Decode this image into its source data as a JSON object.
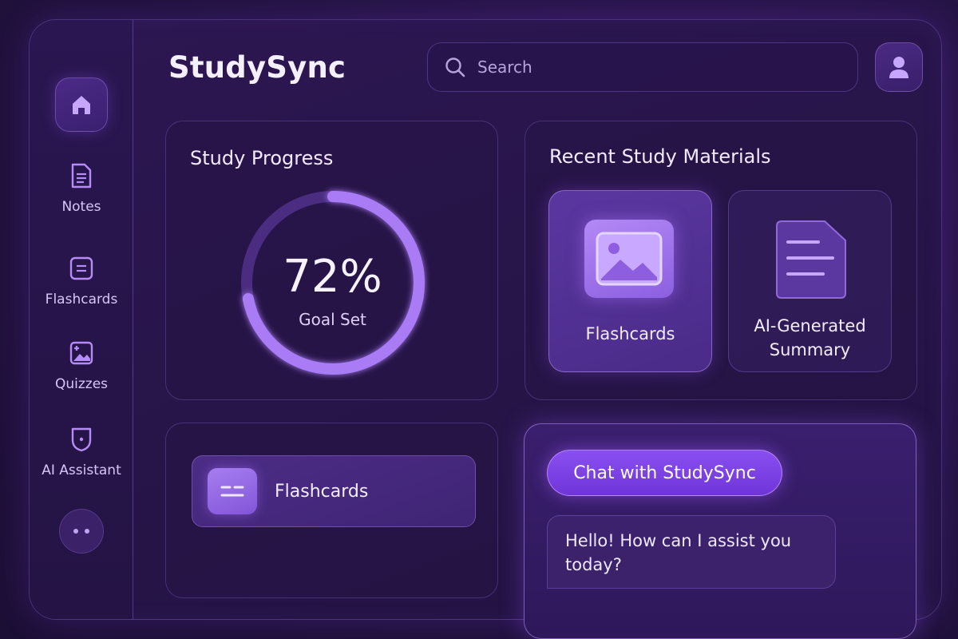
{
  "app": {
    "title": "StudySync"
  },
  "search": {
    "placeholder": "Search",
    "icon": "search-icon"
  },
  "header": {
    "avatar_icon": "user-icon"
  },
  "sidebar": {
    "home_icon": "home-icon",
    "items": [
      {
        "label": "Notes",
        "icon": "document-icon"
      },
      {
        "label": "Flashcards",
        "icon": "card-icon"
      },
      {
        "label": "Quizzes",
        "icon": "image-icon"
      },
      {
        "label": "AI Assistant",
        "icon": "shield-icon"
      }
    ],
    "more_icon": "more-dots-icon"
  },
  "progress": {
    "title": "Study Progress",
    "value_text": "72%",
    "percent": 72,
    "caption": "Goal Set"
  },
  "materials": {
    "title": "Recent Study Materials",
    "cards": [
      {
        "label": "Flashcards",
        "icon": "image-icon"
      },
      {
        "label": "AI-Generated Summary",
        "icon": "document-icon"
      }
    ]
  },
  "flashcards_panel": {
    "label": "Flashcards",
    "icon": "card-icon"
  },
  "chat": {
    "button_label": "Chat with StudySync",
    "message": "Hello! How can I assist you today?"
  },
  "colors": {
    "background": "#22123f",
    "accent": "#8a4ff0",
    "ring_progress": "#a97cf5",
    "ring_track": "#4a2d80",
    "text": "#ece4ff"
  }
}
